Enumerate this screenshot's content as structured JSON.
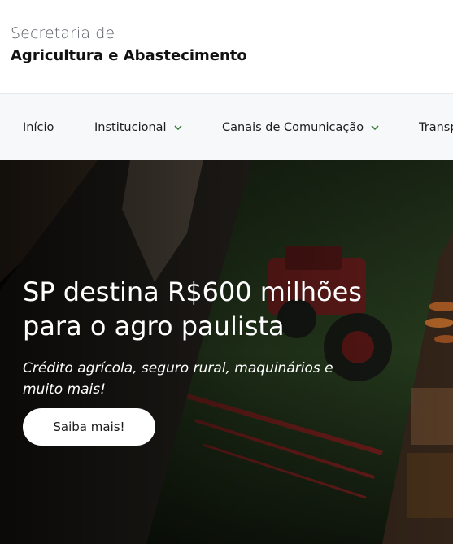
{
  "header": {
    "brand_line1": "Secretaria de",
    "brand_line2": "Agricultura e Abastecimento"
  },
  "nav": {
    "items": [
      {
        "label": "Início"
      },
      {
        "label": "Institucional"
      },
      {
        "label": "Canais de Comunicação"
      },
      {
        "label": "Transp"
      }
    ]
  },
  "hero": {
    "title": "SP destina R$600 milhões para o agro paulista",
    "subtitle": "Crédito agrícola, seguro rural, maquinários e muito mais!",
    "button_label": "Saiba mais!"
  },
  "colors": {
    "nav_bg": "#f6f8fa",
    "chevron": "#3a7d3a",
    "hero_overlay": "#0d0f0b"
  }
}
